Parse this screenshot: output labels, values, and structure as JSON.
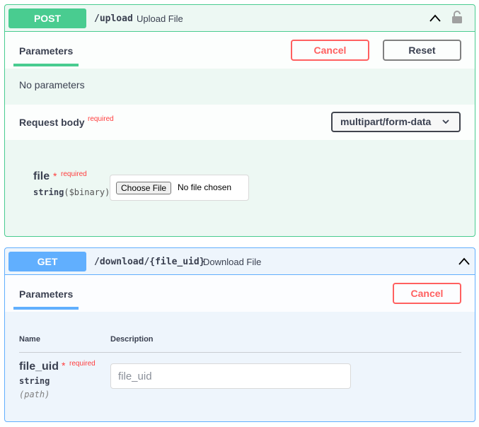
{
  "post_block": {
    "method": "POST",
    "path": "/upload",
    "summary": "Upload File",
    "tab": "Parameters",
    "cancel_label": "Cancel",
    "reset_label": "Reset",
    "no_params": "No parameters",
    "request_body_label": "Request body",
    "required_label": "required",
    "content_type": "multipart/form-data",
    "field": {
      "name": "file",
      "star": "*",
      "required": "required",
      "type_string": "string",
      "type_format": "($binary)"
    },
    "choose_file_label": "Choose File",
    "no_file_label": "No file chosen"
  },
  "get_block": {
    "method": "GET",
    "path": "/download/{file_uid}",
    "summary": "Download File",
    "tab": "Parameters",
    "cancel_label": "Cancel",
    "col_name": "Name",
    "col_description": "Description",
    "param": {
      "name": "file_uid",
      "star": "*",
      "required": "required",
      "type": "string",
      "location": "(path)",
      "placeholder": "file_uid"
    }
  },
  "colors": {
    "post": "#49cc90",
    "get": "#61affe",
    "cancel": "#ff6060",
    "required": "#ff3d3d"
  },
  "icons": [
    "chevron-up-icon",
    "lock-icon",
    "chevron-down-icon"
  ]
}
